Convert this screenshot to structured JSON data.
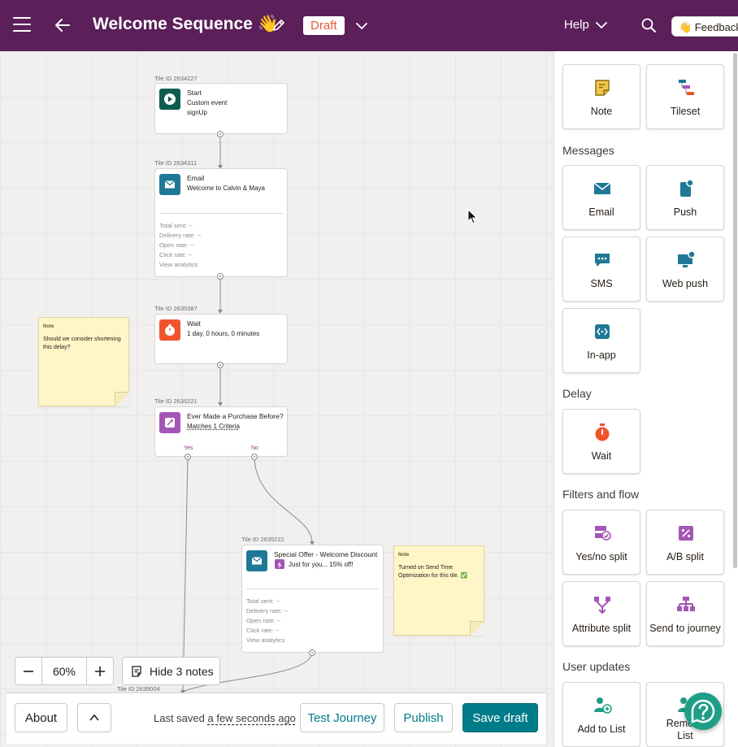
{
  "header": {
    "title": "Welcome Sequence 👋",
    "status_badge": "Draft",
    "help_label": "Help",
    "feedback_label": "👋 Feedback?"
  },
  "canvas": {
    "tiles": {
      "start": {
        "id_label": "Tile ID 2634227",
        "name": "Start",
        "line1": "Custom event",
        "line2": "signUp"
      },
      "email": {
        "id_label": "Tile ID 2634311",
        "name": "Email",
        "line1": "Welcome to Calvin & Maya"
      },
      "wait": {
        "id_label": "Tile ID 2635387",
        "name": "Wait",
        "line1": "1 day, 0 hours, 0 minutes"
      },
      "split": {
        "id_label": "Tile ID 2635221",
        "name": "Ever Made a Purchase Before?",
        "line1": "Matches 1 Criteria",
        "yes": "Yes",
        "no": "No"
      },
      "offer": {
        "id_label": "Tile ID 2635222",
        "name": "Special Offer - Welcome Discount",
        "line1": "Just for you... 15% off!"
      },
      "bottom": {
        "id_label": "Tile ID 2635004"
      }
    },
    "stats": {
      "total_sent": "Total sent:  --",
      "delivery_rate": "Delivery rate:  --",
      "open_rate": "Open rate:  --",
      "click_rate": "Click rate:  --",
      "view_analytics": "View analytics"
    },
    "notes": [
      {
        "title": "Note",
        "text": "Should we consider shortening this delay?"
      },
      {
        "title": "Note",
        "text": "Turned on Send Time Optimization for this tile. ✅"
      }
    ],
    "zoom": {
      "level": "60%",
      "hide_notes_label": "Hide 3 notes"
    }
  },
  "bottom_bar": {
    "about_label": "About",
    "last_saved_prefix": "Last saved",
    "last_saved_rel": "a few seconds ago",
    "test_label": "Test Journey",
    "publish_label": "Publish",
    "save_label": "Save draft"
  },
  "panel": {
    "top": [
      {
        "label": "Note",
        "icon": "note-icon"
      },
      {
        "label": "Tileset",
        "icon": "tileset-icon"
      }
    ],
    "sections": {
      "messages": "Messages",
      "delay": "Delay",
      "filters": "Filters and flow",
      "user_updates": "User updates"
    },
    "messages": [
      {
        "label": "Email",
        "icon": "email-icon"
      },
      {
        "label": "Push",
        "icon": "push-icon"
      },
      {
        "label": "SMS",
        "icon": "sms-icon"
      },
      {
        "label": "Web push",
        "icon": "web-push-icon"
      },
      {
        "label": "In-app",
        "icon": "in-app-icon"
      }
    ],
    "delay": [
      {
        "label": "Wait",
        "icon": "stopwatch-icon"
      }
    ],
    "filters": [
      {
        "label": "Yes/no split",
        "icon": "yes-no-split-icon"
      },
      {
        "label": "A/B split",
        "icon": "ab-split-icon"
      },
      {
        "label": "Attribute split",
        "icon": "attribute-split-icon"
      },
      {
        "label": "Send to journey",
        "icon": "send-to-journey-icon"
      }
    ],
    "user_updates": [
      {
        "label": "Add to List",
        "icon": "add-to-list-icon"
      },
      {
        "label": "Remove\nList",
        "icon": "remove-from-list-icon"
      }
    ]
  },
  "colors": {
    "header_bg": "#5b1f5a",
    "primary": "#007c89",
    "start_icon": "#0d5c4f",
    "email_icon": "#1f7896",
    "wait_icon": "#f0542d",
    "split_icon": "#a356b5",
    "note_bg": "#fff6c8"
  }
}
